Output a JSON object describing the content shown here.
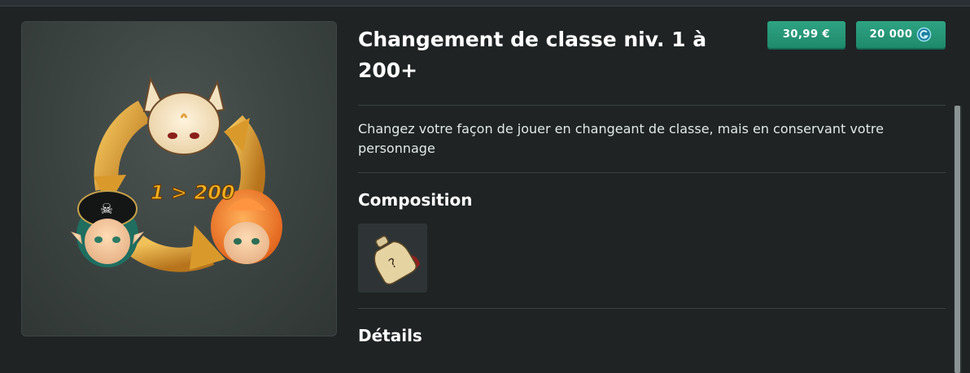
{
  "product": {
    "title": "Changement de classe niv. 1 à 200+",
    "image_text": "1 > 200",
    "description": "Changez votre façon de jouer en changeant de classe, mais en conservant votre personnage"
  },
  "prices": {
    "euro_label": "30,99 €",
    "ogrines_label": "20 000",
    "currency_icon": "ogrine-icon"
  },
  "sections": {
    "composition_title": "Composition",
    "details_title": "Détails"
  },
  "composition": {
    "items": [
      {
        "icon": "potion-bottle-icon"
      }
    ]
  },
  "colors": {
    "background": "#1f2324",
    "button_green": "#2ea383",
    "arrow_gold": "#d99a2b"
  }
}
